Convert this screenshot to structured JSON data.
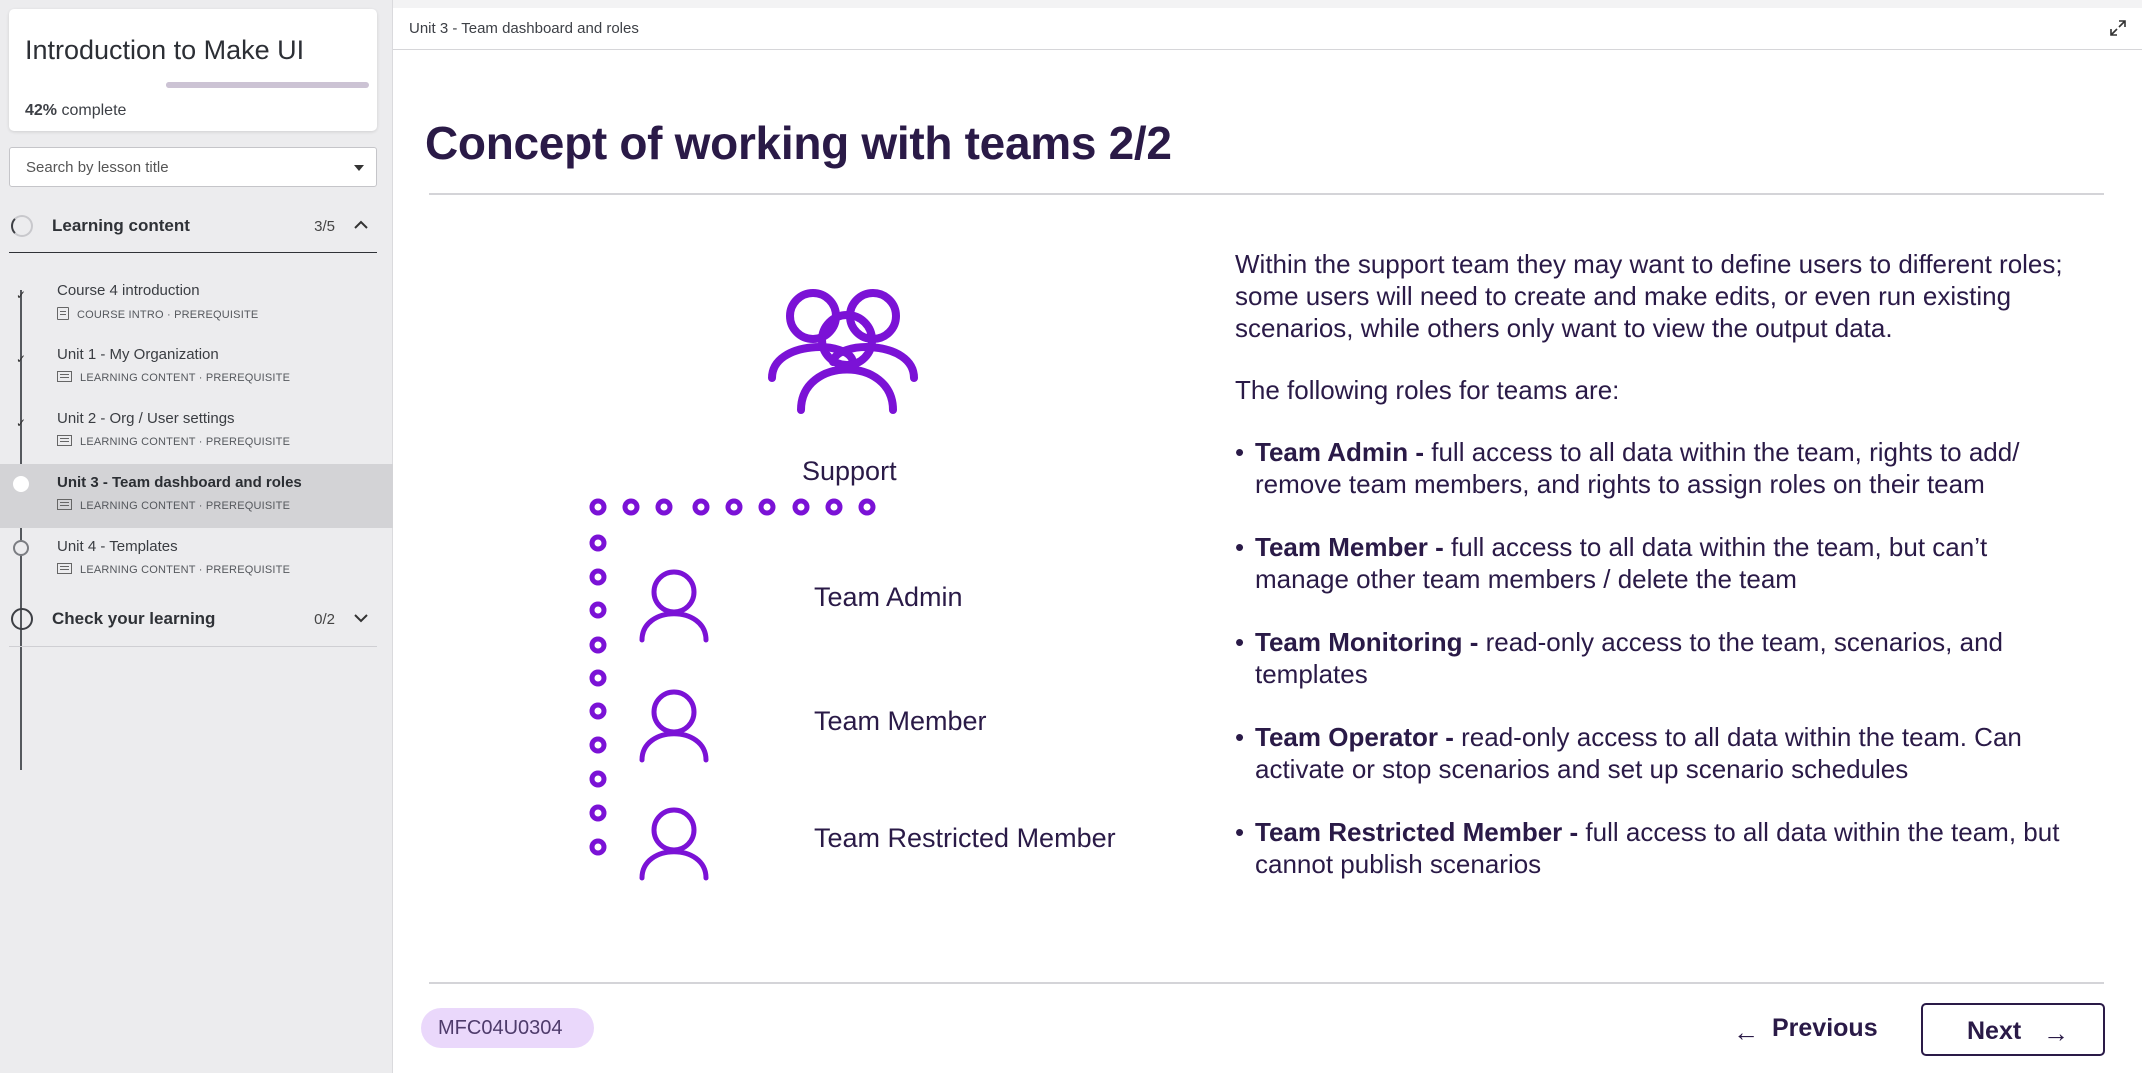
{
  "sidebar": {
    "course_title": "Introduction to Make UI",
    "progress_percent": "42%",
    "progress_suffix": "complete",
    "progress_fraction": 0.42,
    "search_placeholder": "Search by lesson title",
    "sections": [
      {
        "label": "Learning content",
        "count": "3/5",
        "expanded": true,
        "lessons": [
          {
            "title": "Course 4 introduction",
            "meta": "COURSE INTRO · PREREQUISITE",
            "status": "done",
            "icon": "document-icon"
          },
          {
            "title": "Unit 1 - My Organization",
            "meta": "LEARNING CONTENT · PREREQUISITE",
            "status": "done",
            "icon": "screen-icon"
          },
          {
            "title": "Unit 2 - Org / User settings",
            "meta": "LEARNING CONTENT · PREREQUISITE",
            "status": "done",
            "icon": "screen-icon"
          },
          {
            "title": "Unit 3 - Team dashboard and roles",
            "meta": "LEARNING CONTENT · PREREQUISITE",
            "status": "current",
            "icon": "screen-icon"
          },
          {
            "title": "Unit 4 - Templates",
            "meta": "LEARNING CONTENT · PREREQUISITE",
            "status": "not-started",
            "icon": "screen-icon"
          }
        ]
      },
      {
        "label": "Check your learning",
        "count": "0/2",
        "expanded": false
      }
    ]
  },
  "header": {
    "breadcrumb": "Unit 3 - Team dashboard and roles"
  },
  "main": {
    "title": "Concept of working with teams 2/2",
    "illustration": {
      "group_label": "Support",
      "roles": [
        "Team Admin",
        "Team Member",
        "Team Restricted Member"
      ],
      "accent_color": "#7b12d6"
    },
    "intro": "Within the support team they may want to define users to different roles; some users will need to create and make edits, or even run existing scenarios, while others only want to view the output data.",
    "roles_heading": "The following roles for teams are:",
    "roles": [
      {
        "name": "Team Admin -",
        "desc": " full access to all data within the team, rights to add/ remove team members, and rights to assign roles on their team"
      },
      {
        "name": "Team Member -",
        "desc": " full access to all data within the team, but can’t manage other team members / delete the team"
      },
      {
        "name": "Team Monitoring -",
        "desc": " read-only access to the team, scenarios, and templates"
      },
      {
        "name": "Team Operator -",
        "desc": " read-only access to all data within the team. Can activate or stop scenarios and set up scenario schedules"
      },
      {
        "name": "Team Restricted Member -",
        "desc": " full access to all data within the team, but cannot publish scenarios"
      }
    ]
  },
  "footer": {
    "code": "MFC04U0304",
    "prev_label": "Previous",
    "next_label": "Next",
    "prev_arrow": "←",
    "next_arrow": "→"
  },
  "colors": {
    "brand_dark": "#2a1a47",
    "accent_purple": "#7b12d6",
    "badge_bg": "#ead8fb"
  }
}
